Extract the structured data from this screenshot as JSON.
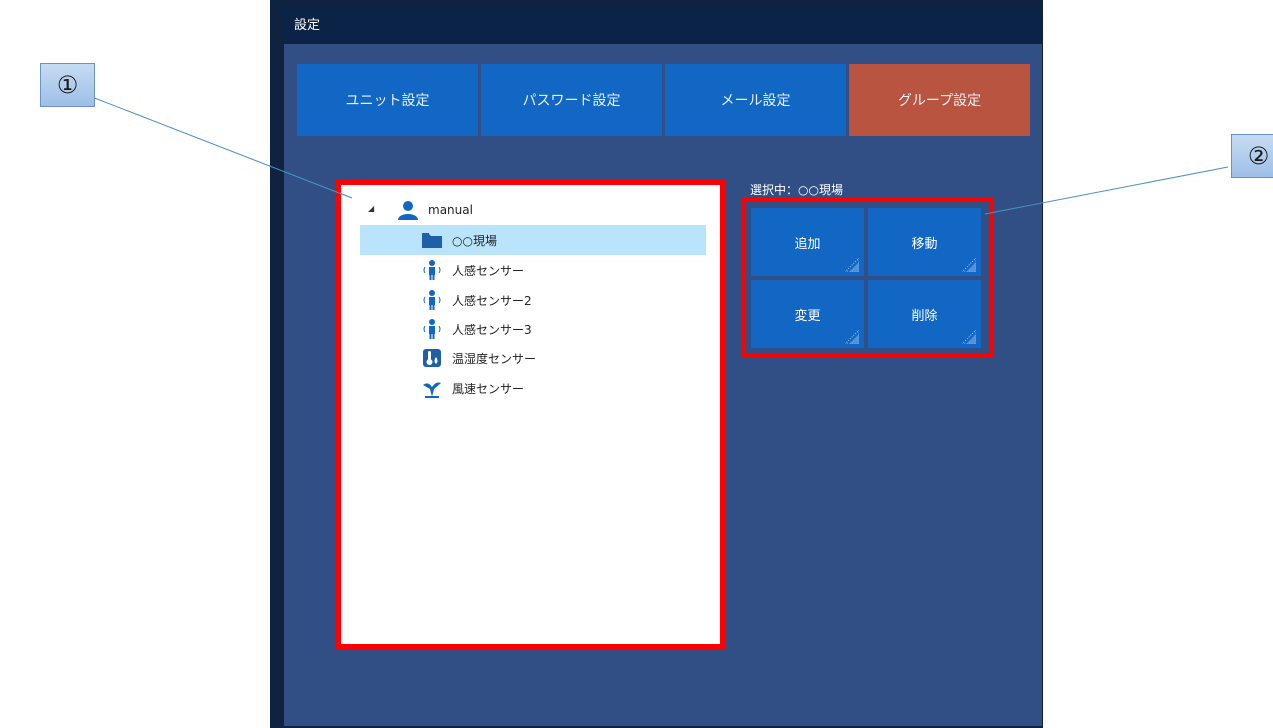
{
  "window": {
    "title": "設定"
  },
  "tabs": [
    {
      "label": "ユニット設定",
      "active": false
    },
    {
      "label": "パスワード設定",
      "active": false
    },
    {
      "label": "メール設定",
      "active": false
    },
    {
      "label": "グループ設定",
      "active": true
    }
  ],
  "tree": {
    "root": {
      "label": "manual",
      "icon": "user-icon"
    },
    "items": [
      {
        "label": "○○現場",
        "icon": "folder-icon",
        "selected": true
      },
      {
        "label": "人感センサー",
        "icon": "motion-sensor-icon"
      },
      {
        "label": "人感センサー2",
        "icon": "motion-sensor-icon"
      },
      {
        "label": "人感センサー3",
        "icon": "motion-sensor-icon"
      },
      {
        "label": "温湿度センサー",
        "icon": "temperature-humidity-sensor-icon"
      },
      {
        "label": "風速センサー",
        "icon": "wind-speed-sensor-icon"
      }
    ]
  },
  "selection": {
    "label": "選択中：○○現場"
  },
  "actions": {
    "add": "追加",
    "move": "移動",
    "change": "変更",
    "delete": "削除"
  },
  "callouts": {
    "one": "①",
    "two": "②"
  },
  "colors": {
    "tab": "#1167c3",
    "tab_active": "#b85440",
    "panel": "#324f85",
    "titlebar": "#0a2347",
    "highlight": "#ff0000",
    "selected_row": "#b9e4fb"
  }
}
